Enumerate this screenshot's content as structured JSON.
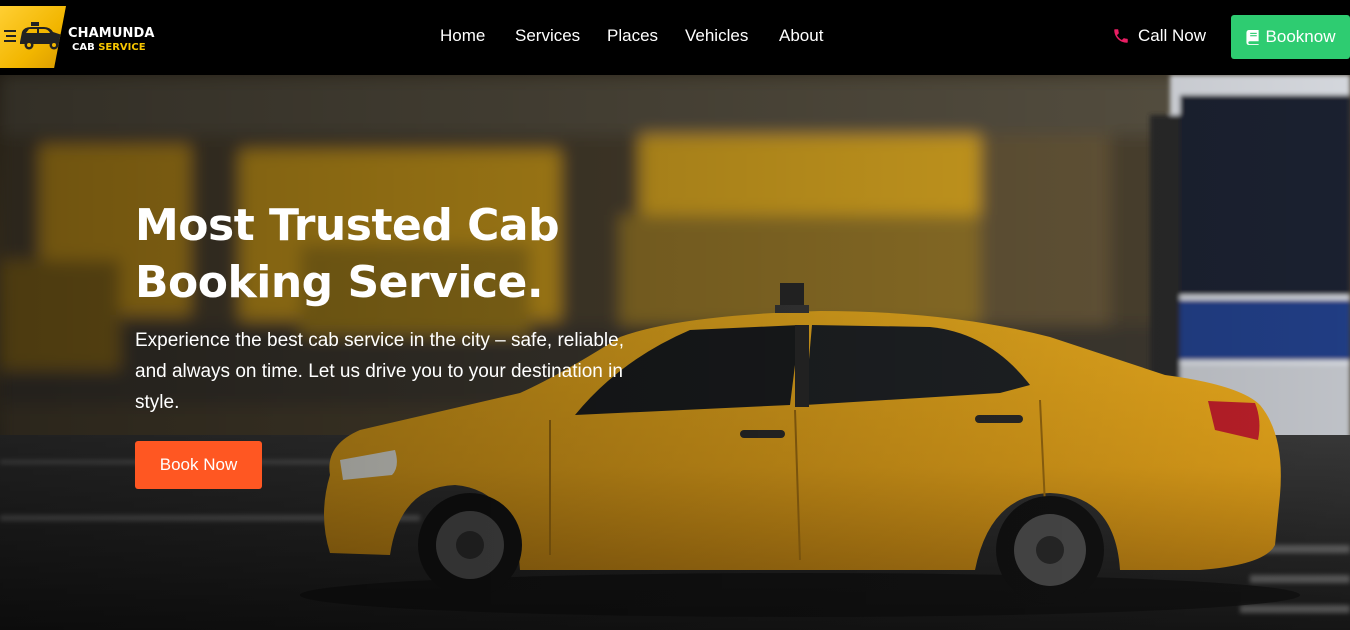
{
  "brand": {
    "name_line1": "CHAMUNDA",
    "name_line2_a": "CAB ",
    "name_line2_b": "SERVICE",
    "accent_color": "#f7c600"
  },
  "nav": {
    "items": [
      {
        "label": "Home"
      },
      {
        "label": "Services"
      },
      {
        "label": "Places"
      },
      {
        "label": "Vehicles"
      },
      {
        "label": "About"
      }
    ],
    "call_label": "Call Now",
    "call_icon": "phone-icon",
    "book_label": "Booknow",
    "book_icon": "book-icon",
    "book_color": "#2ecc71"
  },
  "hero": {
    "title_line1": "Most Trusted Cab",
    "title_line2": "Booking Service.",
    "description": "Experience the best cab service in the city – safe, reliable, and always on time. Let us drive you to your destination in style.",
    "cta_label": "Book Now",
    "cta_color": "#ff5722"
  }
}
